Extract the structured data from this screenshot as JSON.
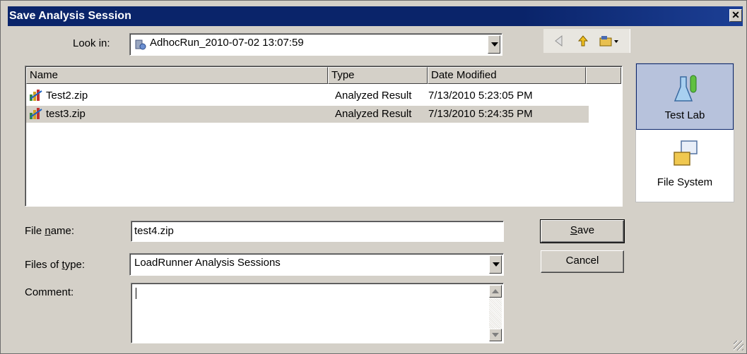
{
  "window": {
    "title": "Save Analysis Session",
    "close_label": "✕"
  },
  "look_in": {
    "label": "Look in:",
    "value": "AdhocRun_2010-07-02 13:07:59"
  },
  "toolbar": {
    "icons": [
      "back-icon",
      "up-folder-icon",
      "view-menu-icon"
    ]
  },
  "file_list": {
    "columns": [
      "Name",
      "Type",
      "Date Modified"
    ],
    "rows": [
      {
        "name": "Test2.zip",
        "type": "Analyzed Result",
        "date": "7/13/2010 5:23:05 PM",
        "selected": false
      },
      {
        "name": "test3.zip",
        "type": "Analyzed Result",
        "date": "7/13/2010 5:24:35 PM",
        "selected": true
      }
    ]
  },
  "places": [
    {
      "label": "Test Lab",
      "icon": "test-lab-icon",
      "selected": true
    },
    {
      "label": "File System",
      "icon": "file-system-icon",
      "selected": false
    }
  ],
  "file_name": {
    "label_pre": "File ",
    "label_u": "n",
    "label_post": "ame:",
    "value": "test4.zip"
  },
  "files_of_type": {
    "label_pre": "Files of ",
    "label_u": "t",
    "label_post": "ype:",
    "value": "LoadRunner Analysis Sessions"
  },
  "comment": {
    "label": "Comment:",
    "value": ""
  },
  "buttons": {
    "save_u": "S",
    "save_rest": "ave",
    "cancel": "Cancel"
  },
  "colors": {
    "titlebar": "#0a246a",
    "dialog_bg": "#d4d0c8",
    "selection_places": "#b7c2dc"
  }
}
